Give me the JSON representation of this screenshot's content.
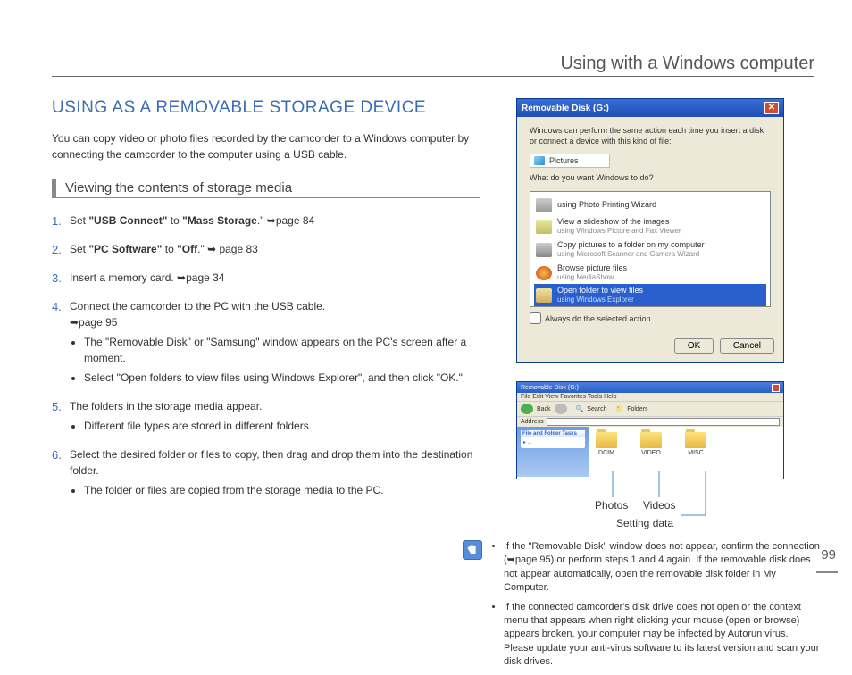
{
  "header": "Using with a Windows computer",
  "title": "USING AS A REMOVABLE STORAGE DEVICE",
  "intro": "You can copy video or photo files recorded by the camcorder to a Windows computer by connecting the camcorder to the computer using a USB cable.",
  "subheading": "Viewing the contents of storage media",
  "steps": {
    "s1_a": "Set ",
    "s1_b": "\"USB Connect\"",
    "s1_c": " to ",
    "s1_d": "\"Mass Storage",
    "s1_e": ".\" ",
    "s1_ref": "➥page 84",
    "s2_a": "Set ",
    "s2_b": "\"PC Software\"",
    "s2_c": " to ",
    "s2_d": "\"Off",
    "s2_e": ".\" ",
    "s2_ref": "➥ page 83",
    "s3": "Insert a memory card. ",
    "s3_ref": "➥page 34",
    "s4": "Connect the camcorder to the PC with the USB cable.",
    "s4_ref": "➥page 95",
    "s4_b1": "The \"Removable Disk\" or \"Samsung\" window appears on the PC's screen after a moment.",
    "s4_b2": "Select \"Open folders to view files using Windows Explorer\", and then click \"OK.\"",
    "s5": "The folders in the storage media appear.",
    "s5_b1": "Different file types are stored in different folders.",
    "s6": "Select the desired folder or files to copy, then drag and drop them into the destination folder.",
    "s6_b1": "The folder or files are copied from the storage media to the PC."
  },
  "dialog": {
    "title": "Removable Disk (G:)",
    "msg": "Windows can perform the same action each time you insert a disk or connect a device with this kind of file:",
    "pictures": "Pictures",
    "prompt": "What do you want Windows to do?",
    "items": [
      {
        "t": "using Photo Printing Wizard",
        "s": ""
      },
      {
        "t": "View a slideshow of the images",
        "s": "using Windows Picture and Fax Viewer"
      },
      {
        "t": "Copy pictures to a folder on my computer",
        "s": "using Microsoft Scanner and Camera Wizard"
      },
      {
        "t": "Browse picture files",
        "s": "using MediaShow"
      },
      {
        "t": "Open folder to view files",
        "s": "using Windows Explorer"
      }
    ],
    "always": "Always do the selected action.",
    "ok": "OK",
    "cancel": "Cancel"
  },
  "explorer": {
    "title": "Removable Disk (G:)",
    "menu": "File   Edit   View   Favorites   Tools   Help",
    "back": "Back",
    "search": "Search",
    "folders_btn": "Folders",
    "address": "Address",
    "tasks_title": "File and Folder Tasks",
    "folders": [
      "DCIM",
      "VIDEO",
      "MISC"
    ]
  },
  "callouts": {
    "photos": "Photos",
    "videos": "Videos",
    "setting": "Setting data"
  },
  "note": {
    "n1": "If the \"Removable Disk\" window does not appear, confirm the connection (➥page 95) or perform steps 1 and 4 again. If the removable disk does not appear automatically, open the removable disk folder in My Computer.",
    "n2": "If the connected camcorder's disk drive does not open or the context menu that appears when right clicking your mouse (open or browse) appears broken, your computer may be infected by Autorun virus.",
    "n2b": "Please update your anti-virus software to its latest version and scan your disk drives."
  },
  "page_num": "99"
}
